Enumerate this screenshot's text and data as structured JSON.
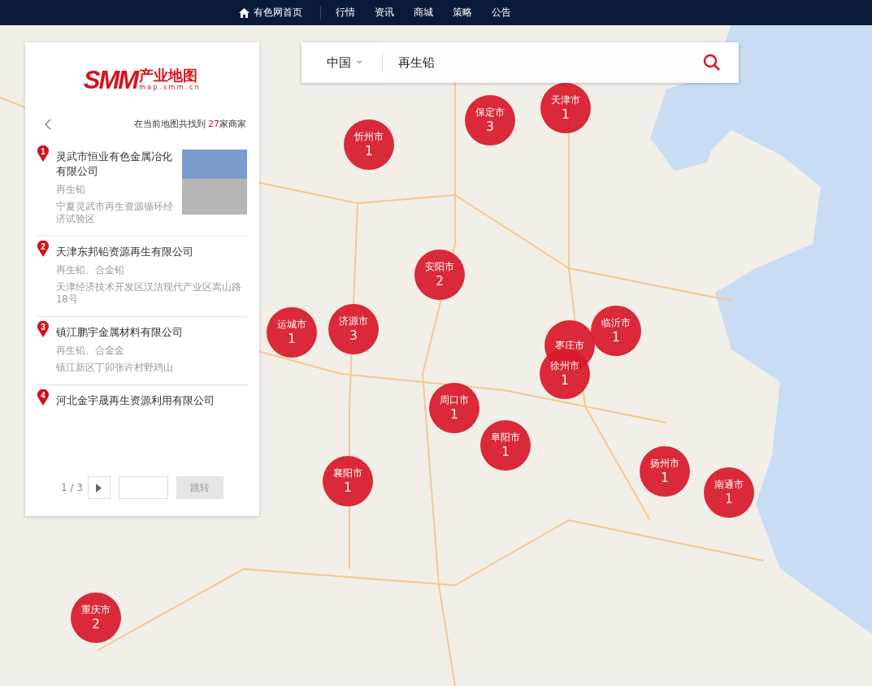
{
  "nav": {
    "home": "有色网首页",
    "links": [
      "行情",
      "资讯",
      "商城",
      "策略",
      "公告"
    ]
  },
  "search": {
    "region": "中国",
    "value": "再生铅"
  },
  "panel": {
    "logo": {
      "mark": "SMM",
      "title": "产业地图",
      "url": "map.smm.cn"
    },
    "summary_before": "在当前地图共找到 ",
    "summary_count": "27",
    "summary_after": "家商家",
    "results": [
      {
        "number": "1",
        "name": "灵武市恒业有色金属冶化有限公司",
        "tags": "再生铅",
        "address": "宁夏灵武市再生资源循环经济试验区",
        "photo": true
      },
      {
        "number": "2",
        "name": "天津东邦铅资源再生有限公司",
        "tags": "再生铅、合金铅",
        "address": "天津经济技术开发区汉沽现代产业区嵩山路18号",
        "photo": false
      },
      {
        "number": "3",
        "name": "镇江鹏宇金属材料有限公司",
        "tags": "再生铅、合金金",
        "address": "镇江新区丁卯张许村野鸡山",
        "photo": false
      },
      {
        "number": "4",
        "name": "河北金宇晟再生资源利用有限公司",
        "photo": false
      }
    ],
    "pager": {
      "page": "1 / 3",
      "go": "跳转"
    }
  },
  "markers": [
    {
      "city": "保定市",
      "count": "3"
    },
    {
      "city": "天津市",
      "count": "1"
    },
    {
      "city": "忻州市",
      "count": "1"
    },
    {
      "city": "安阳市",
      "count": "2"
    },
    {
      "city": "运城市",
      "count": "1"
    },
    {
      "city": "济源市",
      "count": "3"
    },
    {
      "city": "枣庄市"
    },
    {
      "city": "临沂市",
      "count": "1"
    },
    {
      "city": "徐州市",
      "count": "1"
    },
    {
      "city": "周口市",
      "count": "1"
    },
    {
      "city": "阜阳市",
      "count": "1"
    },
    {
      "city": "襄阳市",
      "count": "1"
    },
    {
      "city": "扬州市",
      "count": "1"
    },
    {
      "city": "南通市",
      "count": "1"
    },
    {
      "city": "重庆市",
      "count": "2"
    }
  ]
}
